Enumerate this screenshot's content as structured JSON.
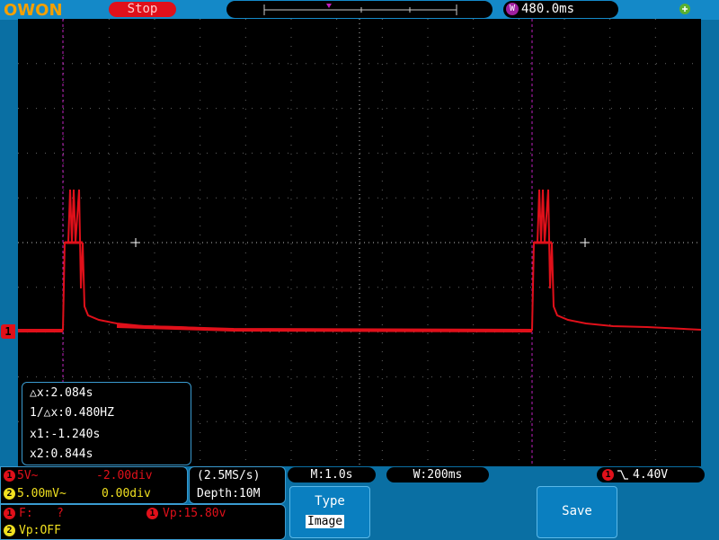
{
  "brand": "OWON",
  "status": "Stop",
  "timebase_delay": "480.0ms",
  "channel1_marker": "1",
  "cursor_readout": {
    "dx": "△x:2.084s",
    "freq": "1/△x:0.480HZ",
    "x1": "x1:-1.240s",
    "x2": "x2:0.844s"
  },
  "ch1": {
    "badge": "1",
    "scale": "5V~",
    "position": "-2.00div"
  },
  "ch2": {
    "badge": "2",
    "scale": "5.00mV~",
    "position": "0.00div"
  },
  "acquisition": {
    "rate": "(2.5MS/s)",
    "depth": "Depth:10M"
  },
  "horizontal": {
    "main": "M:1.0s",
    "window": "W:200ms"
  },
  "trigger": {
    "badge": "1",
    "level": "4.40V"
  },
  "measurements": {
    "freq_label": "F:",
    "freq_value": "?",
    "vp1": "Vp:15.80v",
    "vp2": "Vp:OFF"
  },
  "softkeys": {
    "type_label": "Type",
    "type_value": "Image",
    "save_label": "Save"
  },
  "colors": {
    "ch1": "#e0101a",
    "ch2": "#f0e020",
    "cursor": "#c020c0",
    "background": "#0a6fa3"
  }
}
